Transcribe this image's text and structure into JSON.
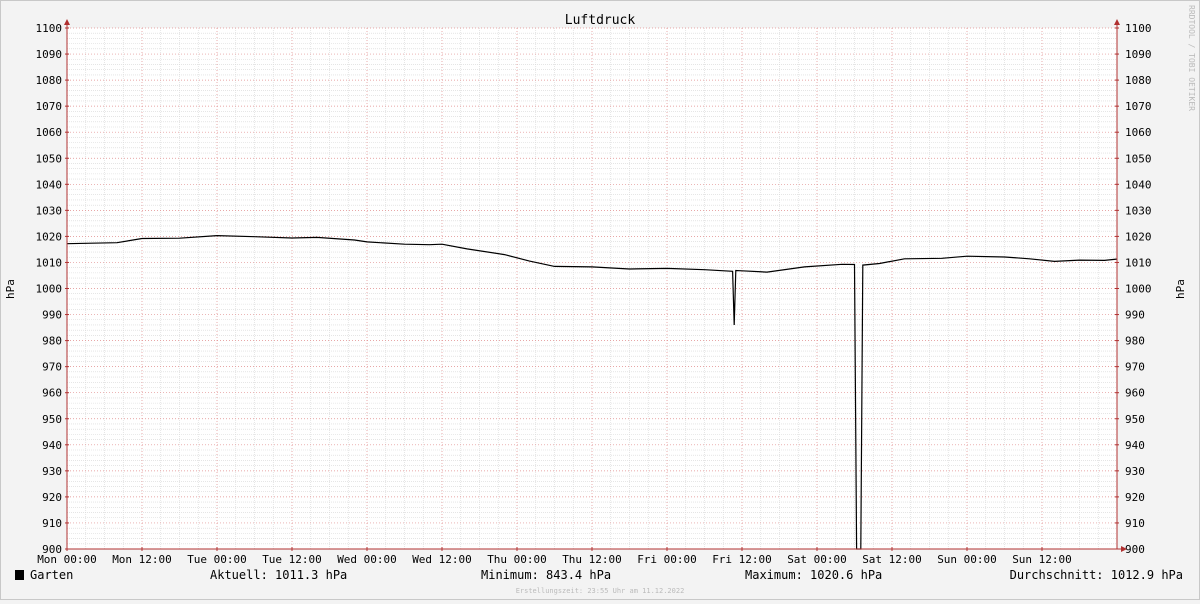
{
  "chart_data": {
    "type": "line",
    "title": "Luftdruck",
    "ylabel": "hPa",
    "ylim": [
      900,
      1100
    ],
    "ystep": 10,
    "xlim": [
      "Mon 00:00",
      "Sun 23:55"
    ],
    "xticks": [
      "Mon 00:00",
      "Mon 12:00",
      "Tue 00:00",
      "Tue 12:00",
      "Wed 00:00",
      "Wed 12:00",
      "Thu 00:00",
      "Thu 12:00",
      "Fri 00:00",
      "Fri 12:00",
      "Sat 00:00",
      "Sat 12:00",
      "Sun 00:00",
      "Sun 12:00"
    ],
    "grid": true,
    "watermark": "RRDTOOL / TOBI OETIKER",
    "series": [
      {
        "name": "Garten",
        "color": "#000000",
        "points": [
          [
            "Mon 00:00",
            1017.2
          ],
          [
            "Mon 08:00",
            1017.6
          ],
          [
            "Mon 12:00",
            1019.2
          ],
          [
            "Mon 18:00",
            1019.3
          ],
          [
            "Tue 00:00",
            1020.3
          ],
          [
            "Tue 06:00",
            1019.9
          ],
          [
            "Tue 12:00",
            1019.4
          ],
          [
            "Tue 16:00",
            1019.6
          ],
          [
            "Tue 22:00",
            1018.6
          ],
          [
            "Wed 00:00",
            1017.9
          ],
          [
            "Wed 06:00",
            1017.0
          ],
          [
            "Wed 10:00",
            1016.8
          ],
          [
            "Wed 12:00",
            1017.0
          ],
          [
            "Wed 16:00",
            1015.2
          ],
          [
            "Wed 22:00",
            1013.0
          ],
          [
            "Thu 02:00",
            1010.5
          ],
          [
            "Thu 06:00",
            1008.5
          ],
          [
            "Thu 12:00",
            1008.3
          ],
          [
            "Thu 18:00",
            1007.5
          ],
          [
            "Fri 00:00",
            1007.7
          ],
          [
            "Fri 06:00",
            1007.2
          ],
          [
            "Fri 10:30",
            1006.6
          ],
          [
            "Fri 10:45",
            986.0
          ],
          [
            "Fri 11:00",
            1006.9
          ],
          [
            "Fri 12:00",
            1006.8
          ],
          [
            "Fri 16:00",
            1006.3
          ],
          [
            "Fri 22:00",
            1008.3
          ],
          [
            "Sat 04:00",
            1009.3
          ],
          [
            "Sat 06:00",
            1009.2
          ],
          [
            "Sat 06:20",
            900.0
          ],
          [
            "Sat 07:00",
            900.0
          ],
          [
            "Sat 07:20",
            1009.0
          ],
          [
            "Sat 10:00",
            1009.6
          ],
          [
            "Sat 14:00",
            1011.4
          ],
          [
            "Sat 20:00",
            1011.6
          ],
          [
            "Sun 00:00",
            1012.4
          ],
          [
            "Sun 06:00",
            1012.1
          ],
          [
            "Sun 10:00",
            1011.4
          ],
          [
            "Sun 14:00",
            1010.4
          ],
          [
            "Sun 18:00",
            1010.9
          ],
          [
            "Sun 22:00",
            1010.8
          ],
          [
            "Sun 23:55",
            1011.3
          ]
        ]
      }
    ]
  },
  "legend": {
    "name": "Garten",
    "current": "Aktuell: 1011.3 hPa",
    "minimum": "Minimum: 843.4 hPa",
    "maximum": "Maximum: 1020.6 hPa",
    "average": "Durchschnitt: 1012.9 hPa"
  },
  "footer": "Erstellungszeit: 23:55 Uhr am 11.12.2022"
}
